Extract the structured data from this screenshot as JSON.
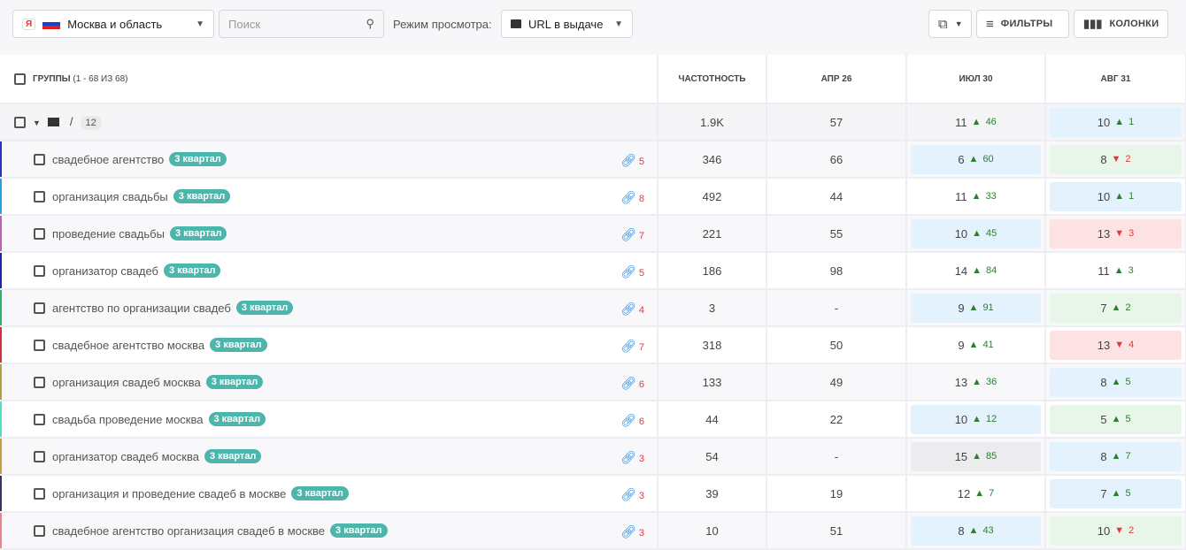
{
  "toolbar": {
    "region": "Москва и область",
    "search_placeholder": "Поиск",
    "mode_label": "Режим просмотра:",
    "mode_value": "URL в выдаче",
    "filters": "ФИЛЬТРЫ",
    "columns": "КОЛОНКИ"
  },
  "table": {
    "headers": {
      "groups": "ГРУППЫ",
      "groups_count": "(1 - 68 ИЗ 68)",
      "freq": "ЧАСТОТНОСТЬ",
      "c1": "АПР 26",
      "c2": "ИЮЛ 30",
      "c3": "АВГ 31"
    },
    "group": {
      "path": "/",
      "count": "12",
      "freq": "1.9K",
      "c1": "57",
      "c2": {
        "v": "11",
        "d": "46",
        "dir": "up",
        "bg": ""
      },
      "c3": {
        "v": "10",
        "d": "1",
        "dir": "up",
        "bg": "blue"
      }
    },
    "rows": [
      {
        "kw": "свадебное агентство",
        "tag": "3 квартал",
        "urls": "5",
        "color": "#3030c0",
        "freq": "346",
        "c1": "66",
        "c2": {
          "v": "6",
          "d": "60",
          "dir": "up",
          "bg": "blue"
        },
        "c3": {
          "v": "8",
          "d": "2",
          "dir": "down",
          "bg": "green"
        }
      },
      {
        "kw": "организация свадьбы",
        "tag": "3 квартал",
        "urls": "8",
        "color": "#2aa0e0",
        "freq": "492",
        "c1": "44",
        "c2": {
          "v": "11",
          "d": "33",
          "dir": "up",
          "bg": ""
        },
        "c3": {
          "v": "10",
          "d": "1",
          "dir": "up",
          "bg": "blue"
        }
      },
      {
        "kw": "проведение свадьбы",
        "tag": "3 квартал",
        "urls": "7",
        "color": "#c060b0",
        "freq": "221",
        "c1": "55",
        "c2": {
          "v": "10",
          "d": "45",
          "dir": "up",
          "bg": "blue"
        },
        "c3": {
          "v": "13",
          "d": "3",
          "dir": "down",
          "bg": "red"
        }
      },
      {
        "kw": "организатор свадеб",
        "tag": "3 квартал",
        "urls": "5",
        "color": "#2020a0",
        "freq": "186",
        "c1": "98",
        "c2": {
          "v": "14",
          "d": "84",
          "dir": "up",
          "bg": ""
        },
        "c3": {
          "v": "11",
          "d": "3",
          "dir": "up",
          "bg": ""
        }
      },
      {
        "kw": "агентство по организации свадеб",
        "tag": "3 квартал",
        "urls": "4",
        "color": "#30b070",
        "freq": "3",
        "c1": "-",
        "c2": {
          "v": "9",
          "d": "91",
          "dir": "up",
          "bg": "blue"
        },
        "c3": {
          "v": "7",
          "d": "2",
          "dir": "up",
          "bg": "green"
        }
      },
      {
        "kw": "свадебное агентство москва",
        "tag": "3 квартал",
        "urls": "7",
        "color": "#d03040",
        "freq": "318",
        "c1": "50",
        "c2": {
          "v": "9",
          "d": "41",
          "dir": "up",
          "bg": ""
        },
        "c3": {
          "v": "13",
          "d": "4",
          "dir": "down",
          "bg": "red"
        }
      },
      {
        "kw": "организация свадеб москва",
        "tag": "3 квартал",
        "urls": "6",
        "color": "#b0a040",
        "freq": "133",
        "c1": "49",
        "c2": {
          "v": "13",
          "d": "36",
          "dir": "up",
          "bg": ""
        },
        "c3": {
          "v": "8",
          "d": "5",
          "dir": "up",
          "bg": "blue"
        }
      },
      {
        "kw": "свадьба проведение москва",
        "tag": "3 квартал",
        "urls": "6",
        "color": "#50e0c0",
        "freq": "44",
        "c1": "22",
        "c2": {
          "v": "10",
          "d": "12",
          "dir": "up",
          "bg": "blue"
        },
        "c3": {
          "v": "5",
          "d": "5",
          "dir": "up",
          "bg": "green"
        }
      },
      {
        "kw": "организатор свадеб москва",
        "tag": "3 квартал",
        "urls": "3",
        "color": "#c0a040",
        "freq": "54",
        "c1": "-",
        "c2": {
          "v": "15",
          "d": "85",
          "dir": "up",
          "bg": "gray"
        },
        "c3": {
          "v": "8",
          "d": "7",
          "dir": "up",
          "bg": "blue"
        }
      },
      {
        "kw": "организация и проведение свадеб в москве",
        "tag": "3 квартал",
        "urls": "3",
        "color": "#403060",
        "freq": "39",
        "c1": "19",
        "c2": {
          "v": "12",
          "d": "7",
          "dir": "up",
          "bg": ""
        },
        "c3": {
          "v": "7",
          "d": "5",
          "dir": "up",
          "bg": "blue"
        }
      },
      {
        "kw": "свадебное агентство организация свадеб в москве",
        "tag": "3 квартал",
        "urls": "3",
        "color": "#f08090",
        "freq": "10",
        "c1": "51",
        "c2": {
          "v": "8",
          "d": "43",
          "dir": "up",
          "bg": "blue"
        },
        "c3": {
          "v": "10",
          "d": "2",
          "dir": "down",
          "bg": "green"
        }
      }
    ]
  }
}
